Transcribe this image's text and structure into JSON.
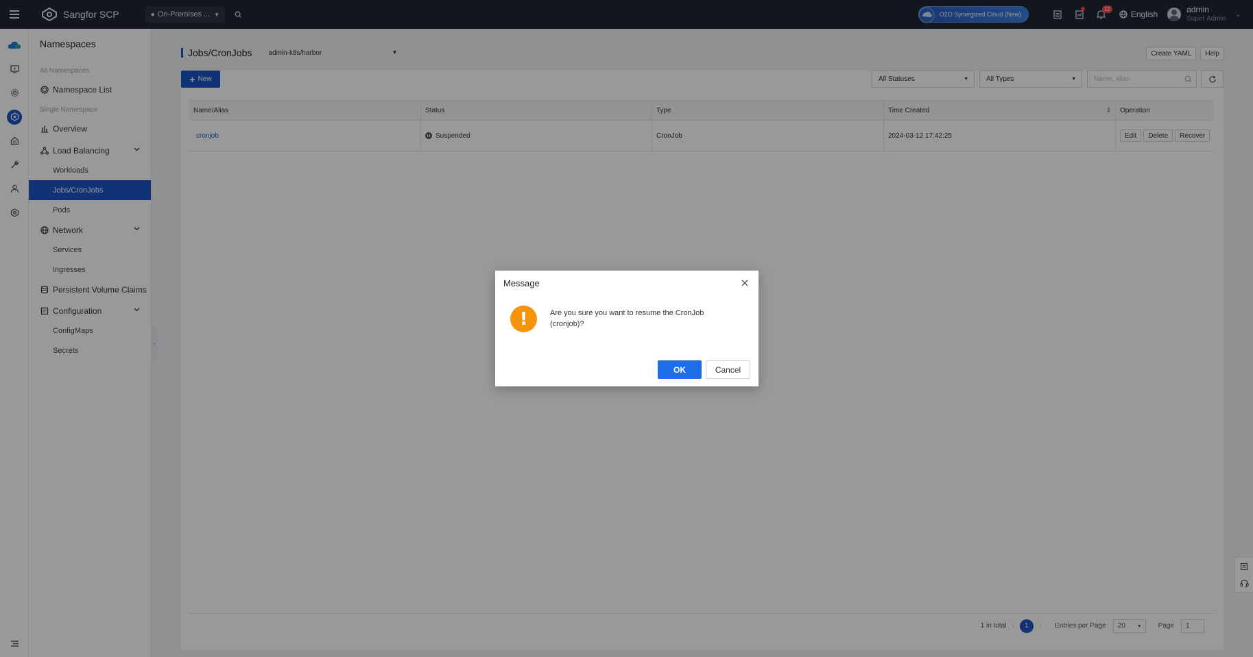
{
  "topbar": {
    "app_name": "Sangfor SCP",
    "location": "On-Premises ...",
    "cloud_badge": "O2O Synergized Cloud (New)",
    "notification_count": "12",
    "language": "English",
    "user_name": "admin",
    "user_role": "Super Admin"
  },
  "rail": {
    "icons": [
      "cloud-icon",
      "monitor-icon",
      "gear-icon",
      "namespace-icon",
      "home-icon",
      "wrench-icon",
      "user-icon",
      "settings-icon"
    ],
    "active_index": 3
  },
  "sidebar": {
    "title": "Namespaces",
    "group_all": "All Namespaces",
    "namespace_list": "Namespace List",
    "group_single": "Single Namespace",
    "overview": "Overview",
    "load_balancing": "Load Balancing",
    "workloads": "Workloads",
    "jobs_cronjobs": "Jobs/CronJobs",
    "pods": "Pods",
    "network": "Network",
    "services": "Services",
    "ingresses": "Ingresses",
    "pvc": "Persistent Volume Claims",
    "configuration": "Configuration",
    "configmaps": "ConfigMaps",
    "secrets": "Secrets"
  },
  "page": {
    "title": "Jobs/CronJobs",
    "namespace": "admin-k8s/harbor",
    "create_yaml": "Create YAML",
    "help": "Help",
    "new_button": "New",
    "status_filter": "All Statuses",
    "type_filter": "All Types",
    "search_placeholder": "Name, alias"
  },
  "table": {
    "headers": [
      "Name/Alias",
      "Status",
      "Type",
      "Time Created",
      "Operation"
    ],
    "rows": [
      {
        "name": "cronjob",
        "status": "Suspended",
        "type": "CronJob",
        "time_created": "2024-03-12 17:42:25",
        "ops": [
          "Edit",
          "Delete",
          "Recover"
        ]
      }
    ]
  },
  "pager": {
    "total": "1 in total",
    "current_page": "1",
    "entries_label": "Entries per Page",
    "entries_value": "20",
    "page_label": "Page",
    "page_input": "1"
  },
  "dialog": {
    "title": "Message",
    "message": "Are you sure you want to resume the CronJob (cronjob)?",
    "ok": "OK",
    "cancel": "Cancel"
  },
  "colors": {
    "brand": "#1d56c5",
    "topbar": "#1f2532",
    "warning": "#f5940b",
    "ok_button": "#1d6ee8"
  }
}
